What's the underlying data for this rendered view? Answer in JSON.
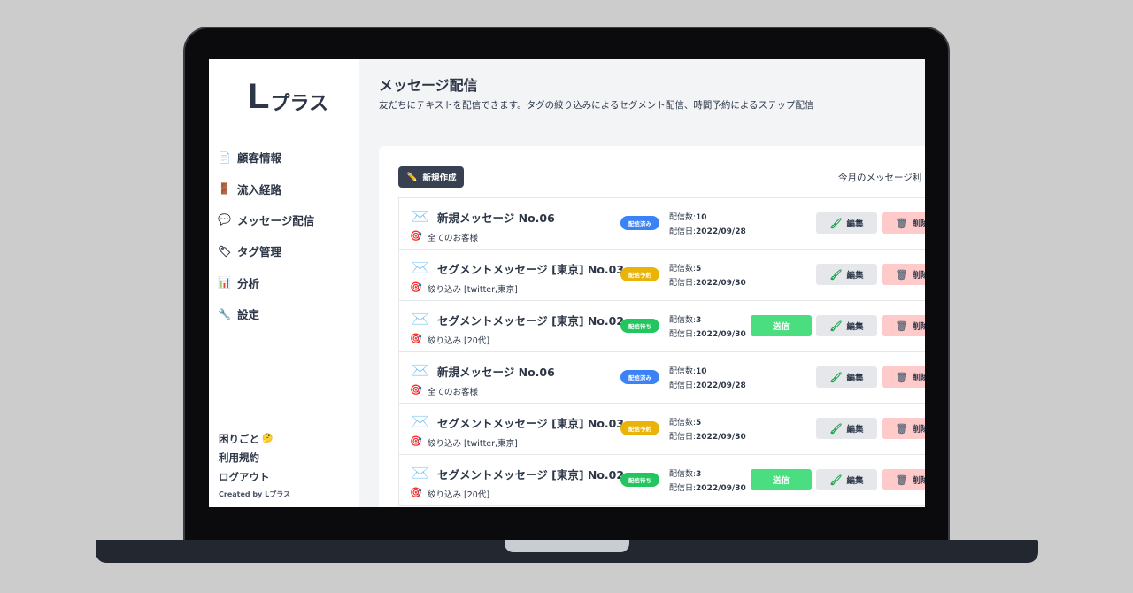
{
  "app": {
    "logo_l": "L",
    "logo_rest": "プラス"
  },
  "sidebar": {
    "items": [
      {
        "label": "顧客情報",
        "icon": "document-icon"
      },
      {
        "label": "流入経路",
        "icon": "door-icon"
      },
      {
        "label": "メッセージ配信",
        "icon": "speech-bubble-icon"
      },
      {
        "label": "タグ管理",
        "icon": "tag-icon"
      },
      {
        "label": "分析",
        "icon": "bar-chart-icon"
      },
      {
        "label": "設定",
        "icon": "wrench-icon"
      }
    ],
    "help_label": "困りごと",
    "terms_label": "利用規約",
    "logout_label": "ログアウト",
    "credit": "Created by Lプラス"
  },
  "header": {
    "title": "メッセージ配信",
    "description": "友だちにテキストを配信できます。タグの絞り込みによるセグメント配信、時間予約によるステップ配信"
  },
  "toolbar": {
    "new_label": "新規作成",
    "usage_text": "今月のメッセージ利"
  },
  "labels": {
    "count_prefix": "配信数:",
    "date_prefix": "配信日:",
    "send": "送信",
    "edit": "編集",
    "delete": "削除"
  },
  "status_colors": {
    "配信済み": "#3b82f6",
    "配信予約": "#eab308",
    "配信待ち": "#22c55e"
  },
  "messages": [
    {
      "title": "新規メッセージ No.06",
      "target": "全てのお客様",
      "status": "配信済み",
      "count": "10",
      "date": "2022/09/28",
      "send": false
    },
    {
      "title": "セグメントメッセージ [東京] No.03",
      "target": "絞り込み [twitter,東京]",
      "status": "配信予約",
      "count": "5",
      "date": "2022/09/30",
      "send": false
    },
    {
      "title": "セグメントメッセージ [東京] No.02",
      "target": "絞り込み [20代]",
      "status": "配信待ち",
      "count": "3",
      "date": "2022/09/30",
      "send": true
    },
    {
      "title": "新規メッセージ No.06",
      "target": "全てのお客様",
      "status": "配信済み",
      "count": "10",
      "date": "2022/09/28",
      "send": false
    },
    {
      "title": "セグメントメッセージ [東京] No.03",
      "target": "絞り込み [twitter,東京]",
      "status": "配信予約",
      "count": "5",
      "date": "2022/09/30",
      "send": false
    },
    {
      "title": "セグメントメッセージ [東京] No.02",
      "target": "絞り込み [20代]",
      "status": "配信待ち",
      "count": "3",
      "date": "2022/09/30",
      "send": true
    }
  ]
}
